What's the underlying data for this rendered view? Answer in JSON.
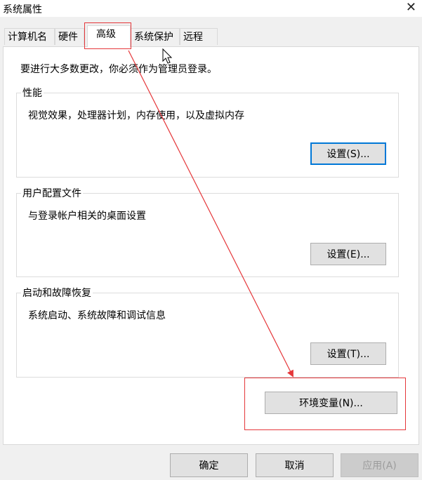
{
  "window": {
    "title": "系统属性",
    "close_glyph": "✕"
  },
  "tabs": [
    {
      "label": "计算机名",
      "active": false
    },
    {
      "label": "硬件",
      "active": false
    },
    {
      "label": "高级",
      "active": true
    },
    {
      "label": "系统保护",
      "active": false
    },
    {
      "label": "远程",
      "active": false
    }
  ],
  "advanced": {
    "admin_note": "要进行大多数更改，你必须作为管理员登录。",
    "groups": [
      {
        "title": "性能",
        "description": "视觉效果，处理器计划，内存使用，以及虚拟内存",
        "button": "设置(S)..."
      },
      {
        "title": "用户配置文件",
        "description": "与登录帐户相关的桌面设置",
        "button": "设置(E)..."
      },
      {
        "title": "启动和故障恢复",
        "description": "系统启动、系统故障和调试信息",
        "button": "设置(T)..."
      }
    ],
    "env_button": "环境变量(N)..."
  },
  "footer": {
    "ok": "确定",
    "cancel": "取消",
    "apply": "应用(A)"
  },
  "annotation": {
    "color": "#e5373a"
  },
  "icons": {
    "close": "close-icon",
    "cursor": "mouse-cursor-icon"
  }
}
